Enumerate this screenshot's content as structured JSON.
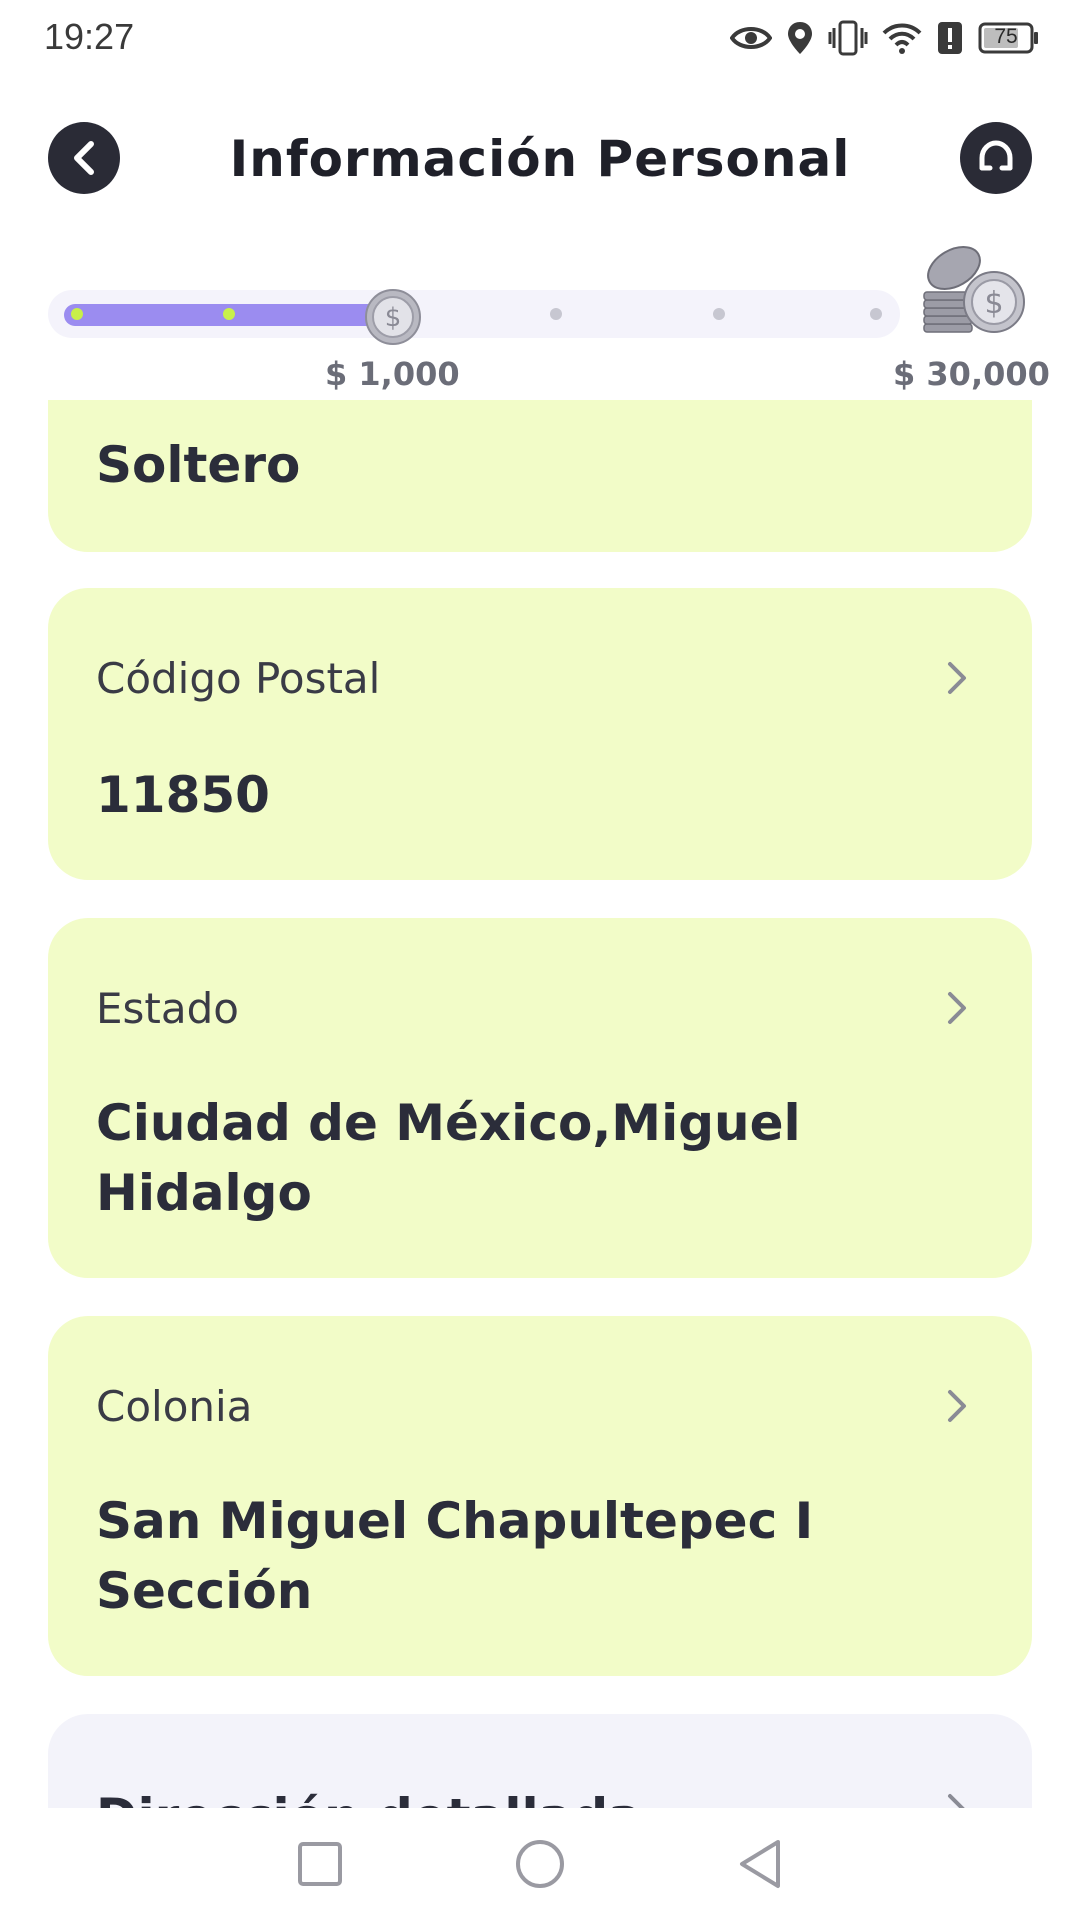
{
  "status_bar": {
    "time": "19:27",
    "battery": "75",
    "icons": [
      "eye-icon",
      "location-icon",
      "vibrate-icon",
      "wifi-icon",
      "alert-icon",
      "battery-icon"
    ]
  },
  "header": {
    "title": "Información Personal",
    "back_icon": "chevron-left-icon",
    "support_icon": "headset-icon"
  },
  "progress": {
    "current_amount": "$ 1,000",
    "goal_amount": "$ 30,000",
    "fraction_complete": 0.38,
    "steps_total": 6,
    "steps_completed": 2
  },
  "cards": [
    {
      "label": "",
      "value": "Soltero"
    },
    {
      "label": "Código Postal",
      "value": "11850"
    },
    {
      "label": "Estado",
      "value": "Ciudad de México,Miguel Hidalgo"
    },
    {
      "label": "Colonia",
      "value": "San Miguel Chapultepec I Sección"
    },
    {
      "label": "Dirección detallada",
      "value": ""
    }
  ],
  "nav_bar": {
    "recent_icon": "square-icon",
    "home_icon": "circle-icon",
    "back_icon": "triangle-back-icon"
  },
  "colors": {
    "accent_purple": "#9b8cf0",
    "card_green": "#f2fcc8",
    "card_grey": "#f3f3fa",
    "dark": "#2a2b36"
  }
}
